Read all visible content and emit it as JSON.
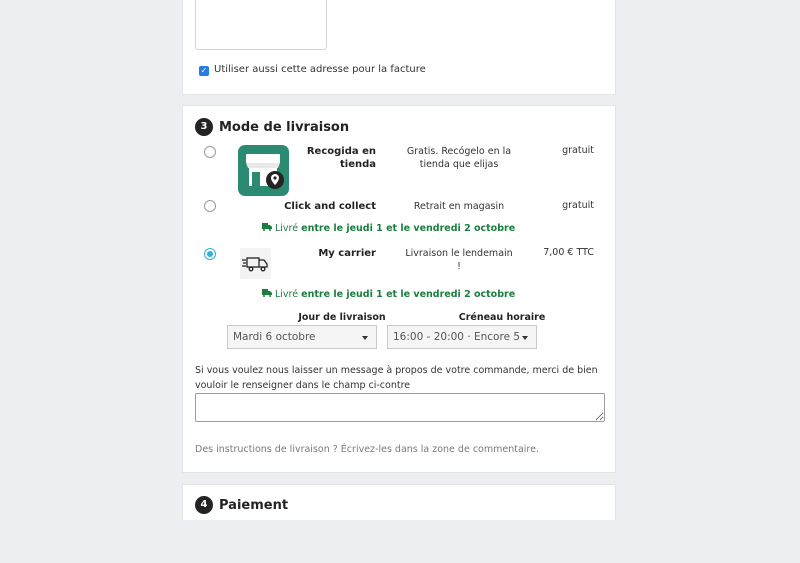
{
  "address_section": {
    "use_for_invoice_label": "Utiliser aussi cette adresse pour la facture",
    "use_for_invoice_checked": true
  },
  "delivery_section": {
    "step_number": "3",
    "title": "Mode de livraison",
    "carriers": [
      {
        "name": "Recogida en tienda",
        "description": "Gratis. Recógelo en la tienda que elijas",
        "price": "gratuit",
        "selected": false,
        "icon": "store-pin-icon"
      },
      {
        "name": "Click and collect",
        "description": "Retrait en magasin",
        "price": "gratuit",
        "selected": false,
        "delivery_prefix": "Livré",
        "delivery_window": "entre le jeudi 1 et le vendredi 2 octobre"
      },
      {
        "name": "My carrier",
        "description": "Livraison le lendemain !",
        "price": "7,00 € TTC",
        "selected": true,
        "icon": "delivery-truck-icon",
        "delivery_prefix": "Livré",
        "delivery_window": "entre le jeudi 1 et le vendredi 2 octobre"
      }
    ],
    "delivery_day": {
      "label": "Jour de livraison",
      "value": "Mardi 6 octobre"
    },
    "time_slot": {
      "label": "Créneau horaire",
      "value": "16:00 - 20:00 · Encore 5"
    },
    "message_prompt": "Si vous voulez nous laisser un message à propos de votre commande, merci de bien vouloir le renseigner dans le champ ci-contre",
    "instructions_hint": "Des instructions de livraison ? Écrivez-les dans la zone de commentaire."
  },
  "payment_section": {
    "step_number": "4",
    "title": "Paiement"
  },
  "colors": {
    "page_background": "#eceef1",
    "delivery_green": "#1b7e3f",
    "radio_accent": "#2fb5d2",
    "store_logo_bg": "#2a8a72"
  }
}
